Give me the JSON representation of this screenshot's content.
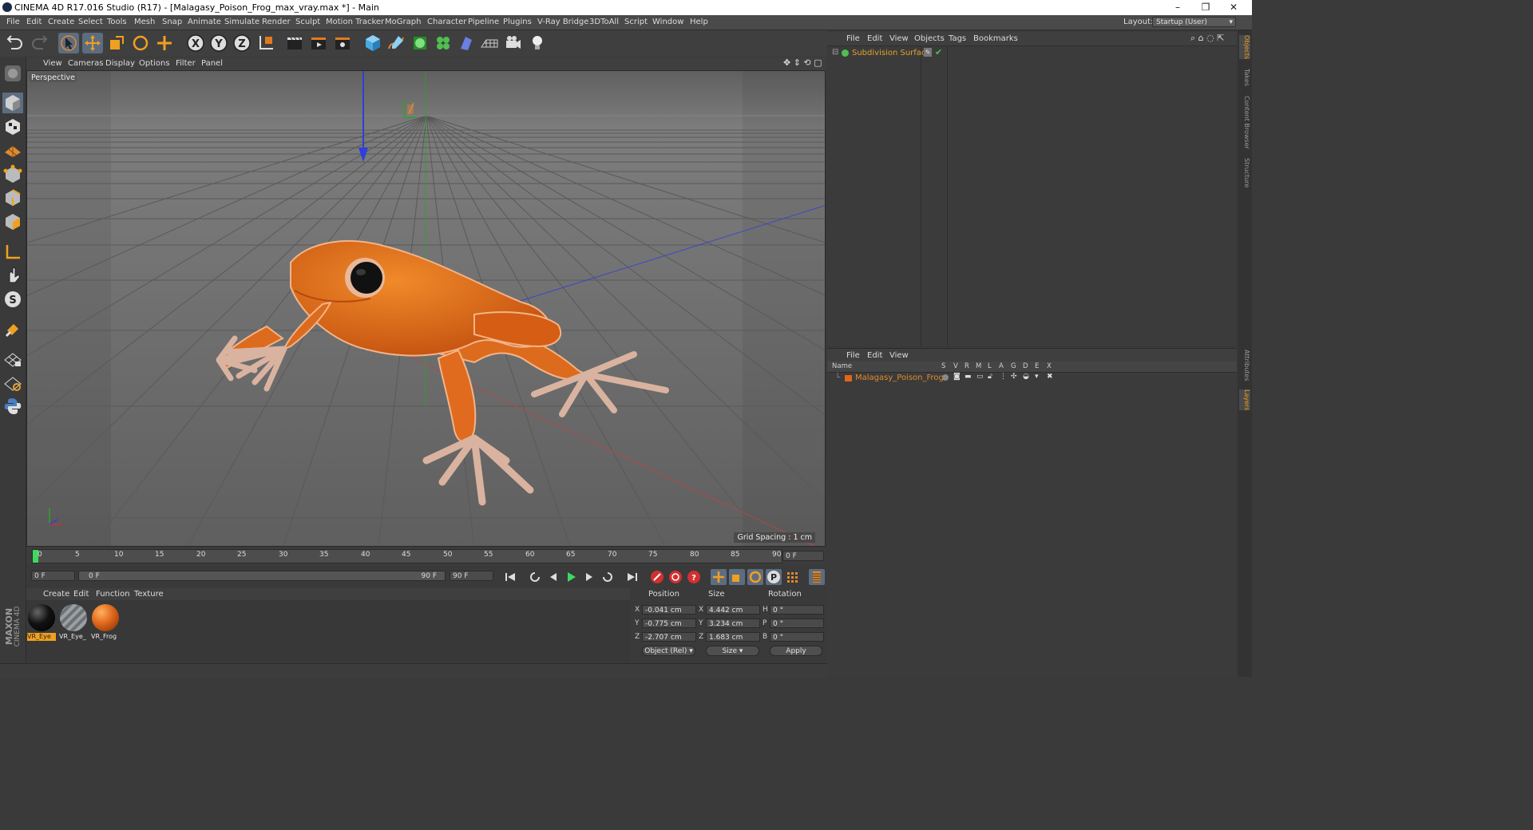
{
  "window": {
    "title": "CINEMA 4D R17.016 Studio (R17) - [Malagasy_Poison_Frog_max_vray.max *] - Main",
    "controls": [
      "–",
      "❐",
      "✕"
    ]
  },
  "menubar": {
    "items": [
      "File",
      "Edit",
      "Create",
      "Select",
      "Tools",
      "Mesh",
      "Snap",
      "Animate",
      "Simulate",
      "Render",
      "Sculpt",
      "Motion Tracker",
      "MoGraph",
      "Character",
      "Pipeline",
      "Plugins",
      "V-Ray Bridge",
      "3DToAll",
      "Script",
      "Window",
      "Help"
    ],
    "layout_label": "Layout:",
    "layout_value": "Startup (User)"
  },
  "viewport": {
    "menu": [
      "View",
      "Cameras",
      "Display",
      "Options",
      "Filter",
      "Panel"
    ],
    "label": "Perspective",
    "grid_spacing": "Grid Spacing : 1 cm"
  },
  "timeline": {
    "ticks": [
      "0",
      "5",
      "10",
      "15",
      "20",
      "25",
      "30",
      "35",
      "40",
      "45",
      "50",
      "55",
      "60",
      "65",
      "70",
      "75",
      "80",
      "85",
      "90"
    ],
    "end_field": "0 F",
    "start_field": "0 F",
    "range_start": "0 F",
    "range_end": "90 F",
    "max_field": "90 F"
  },
  "materials": {
    "menu": [
      "Create",
      "Edit",
      "Function",
      "Texture"
    ],
    "items": [
      {
        "label": "VR_Eye",
        "color": "#111111",
        "selected": true
      },
      {
        "label": "VR_Eye_",
        "color": "#777c80",
        "selected": false
      },
      {
        "label": "VR_Frog",
        "color": "#e0661a",
        "selected": false
      }
    ],
    "brand_line1": "MAXON",
    "brand_line2": "CINEMA 4D"
  },
  "coordinates": {
    "headers": [
      "Position",
      "Size",
      "Rotation"
    ],
    "rows": [
      {
        "axis": "X",
        "pos": "-0.041 cm",
        "size_axis": "X",
        "size": "4.442 cm",
        "rot_axis": "H",
        "rot": "0 °"
      },
      {
        "axis": "Y",
        "pos": "-0.775 cm",
        "size_axis": "Y",
        "size": "3.234 cm",
        "rot_axis": "P",
        "rot": "0 °"
      },
      {
        "axis": "Z",
        "pos": "-2.707 cm",
        "size_axis": "Z",
        "size": "1.683 cm",
        "rot_axis": "B",
        "rot": "0 °"
      }
    ],
    "mode": "Object (Rel)",
    "size_mode": "Size",
    "apply": "Apply"
  },
  "objects": {
    "menu": [
      "File",
      "Edit",
      "View",
      "Objects",
      "Tags",
      "Bookmarks"
    ],
    "items": [
      {
        "name": "Subdivision Surface",
        "color": "#e3a42a"
      }
    ]
  },
  "layers": {
    "menu": [
      "File",
      "Edit",
      "View"
    ],
    "columns": [
      "Name",
      "S",
      "V",
      "R",
      "M",
      "L",
      "A",
      "G",
      "D",
      "E",
      "X"
    ],
    "items": [
      {
        "name": "Malagasy_Poison_Frog",
        "color": "#e08a2a"
      }
    ]
  },
  "right_tabs": [
    "Objects",
    "Takes",
    "Content Browser",
    "Structure",
    "Attributes",
    "Layers"
  ],
  "colors": {
    "accent": "#f0a020",
    "frog": "#e0661a",
    "axis_x": "#d23030",
    "axis_y": "#2fa02f",
    "axis_z": "#2f3fd8"
  }
}
